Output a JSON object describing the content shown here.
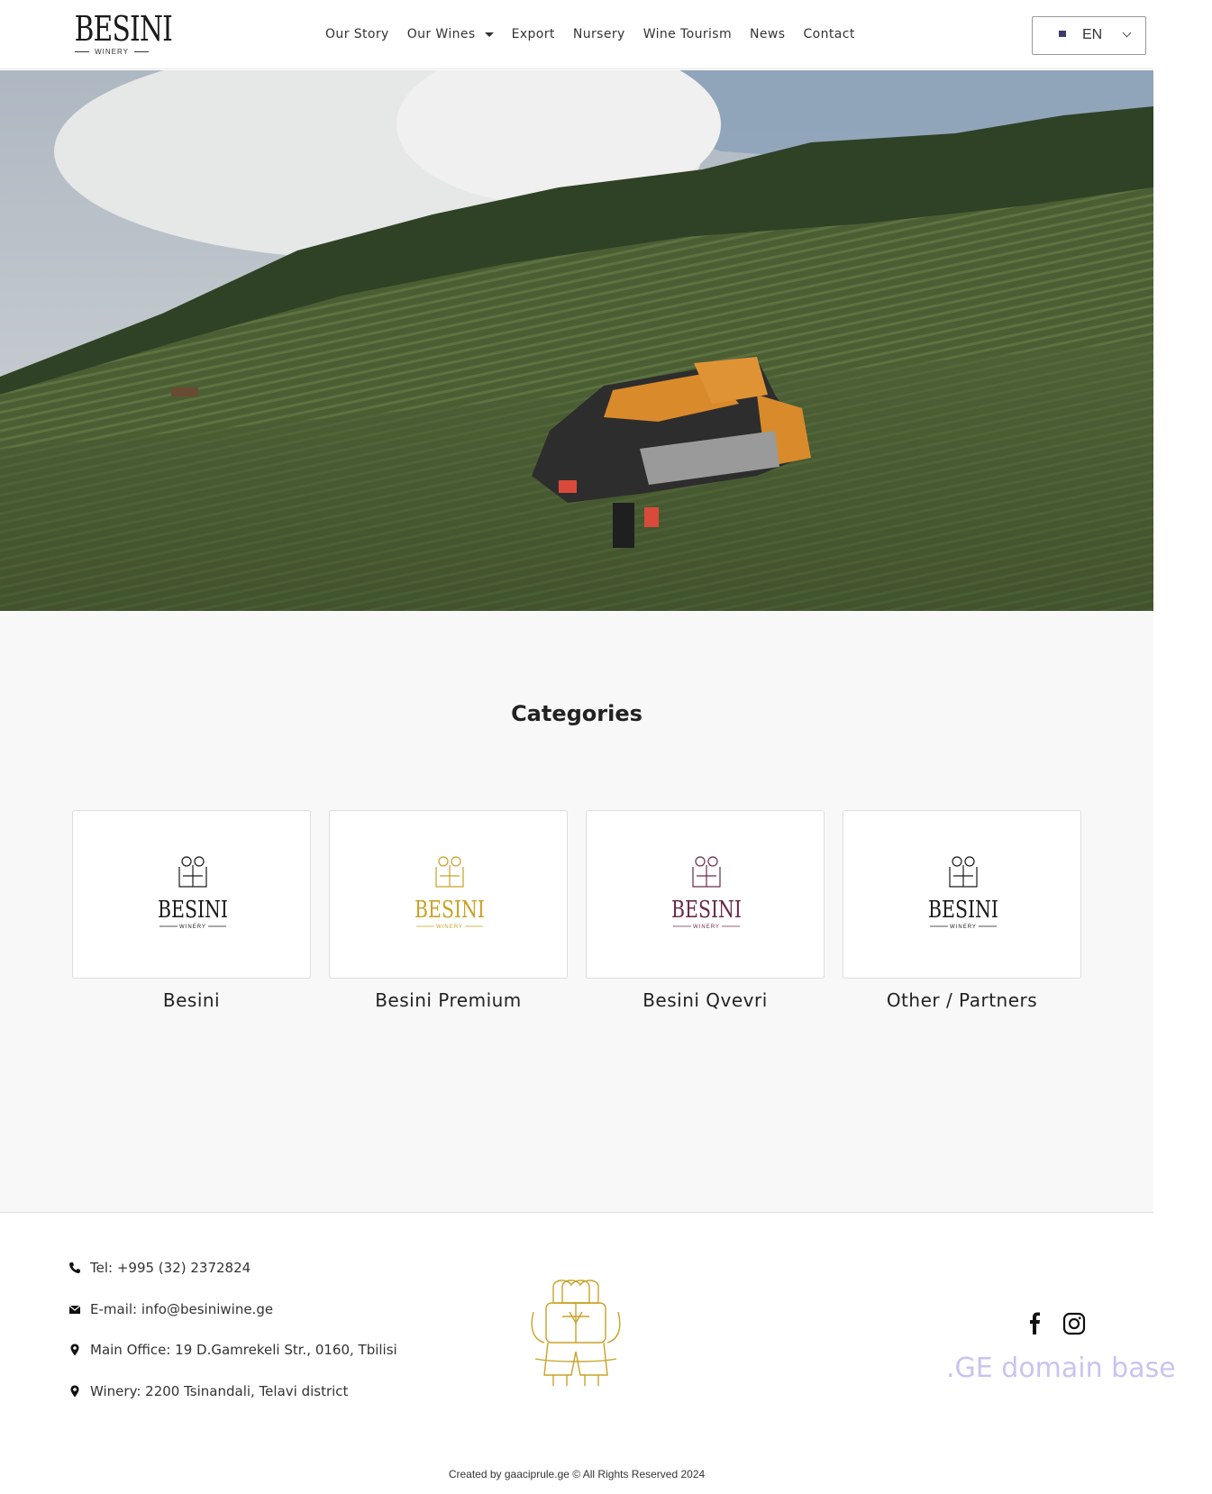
{
  "header": {
    "logo": {
      "word": "BESINI",
      "sub": "WINERY"
    },
    "nav": [
      "Our Story",
      "Our Wines",
      "Export",
      "Nursery",
      "Wine Tourism",
      "News",
      "Contact"
    ],
    "language": {
      "code": "EN",
      "flag": "us-flag-icon"
    }
  },
  "hero": {
    "image": "vineyard-harvester-photo"
  },
  "categories": {
    "title": "Categories",
    "items": [
      {
        "label": "Besini",
        "color": "#1a1a1a"
      },
      {
        "label": "Besini Premium",
        "color": "#c9a227"
      },
      {
        "label": "Besini Qvevri",
        "color": "#6b2a4a"
      },
      {
        "label": "Other / Partners",
        "color": "#1a1a1a"
      }
    ]
  },
  "footer": {
    "contacts": [
      {
        "icon": "phone-icon",
        "text": "Tel: +995 (32) 2372824"
      },
      {
        "icon": "envelope-icon",
        "text": "E-mail: info@besiniwine.ge"
      },
      {
        "icon": "map-pin-icon",
        "text": "Main Office: 19 D.Gamrekeli Str., 0160, Tbilisi"
      },
      {
        "icon": "map-pin-icon",
        "text": "Winery: 2200 Tsinandali, Telavi district"
      }
    ],
    "emblem_color": "#c9a227",
    "social": [
      "facebook-icon",
      "instagram-icon"
    ],
    "watermark": ".GE domain base",
    "credit": "Created by gaaciprule.ge © All Rights Reserved 2024"
  }
}
